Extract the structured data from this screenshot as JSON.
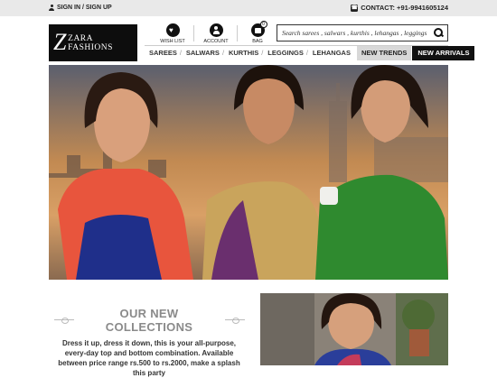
{
  "topbar": {
    "signin_label": "SIGN IN / SIGN UP",
    "contact_label": "CONTACT: +91-9941605124"
  },
  "brand": {
    "logo_mark": "Z",
    "name": "ZARA FASHIONS"
  },
  "header_icons": {
    "wishlist_label": "WISH LIST",
    "account_label": "ACCOUNT",
    "bag_label": "BAG",
    "bag_count": "0"
  },
  "search": {
    "placeholder": "Search sarees , salwars , kurthis , lehangas , leggings"
  },
  "nav": {
    "items": [
      "SAREES",
      "SALWARS",
      "KURTHIS",
      "LEGGINGS",
      "LEHANGAS"
    ],
    "new_trends": "NEW TRENDS",
    "new_arrivals": "NEW ARRIVALS"
  },
  "collections": {
    "title": "OUR NEW COLLECTIONS",
    "description": "Dress it up, dress it down, this is your all-purpose, every-day top and bottom combination. Available between price range rs.500 to rs.2000, make a splash this party"
  },
  "colors": {
    "topbar_bg": "#e9e9e9",
    "logo_bg": "#0d0d0d",
    "active_tab": "#111111",
    "trend_tab": "#d8d8d8"
  }
}
